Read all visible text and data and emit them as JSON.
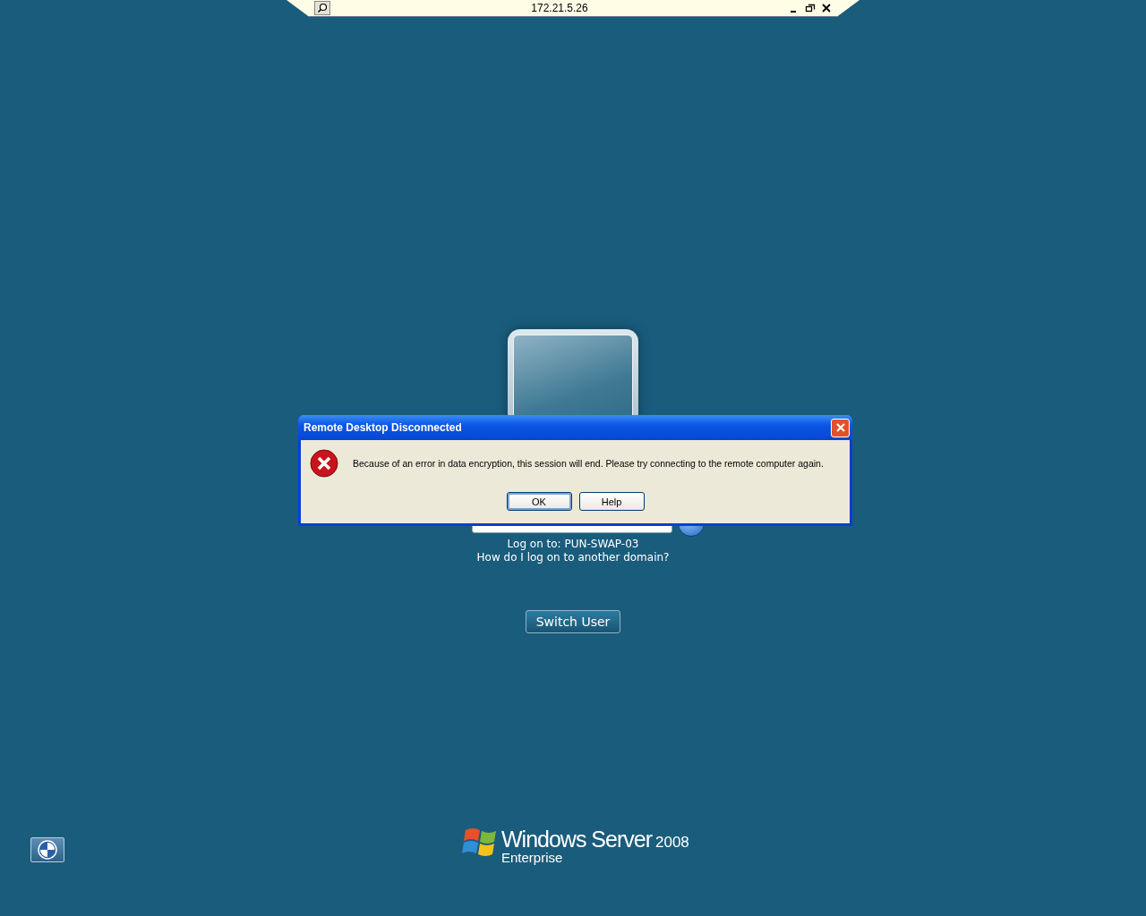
{
  "connection_bar": {
    "title": "172.21.5.26"
  },
  "login": {
    "host_label": "Log on to: PUN-SWAP-03",
    "domain_link": "How do I log on to another domain?",
    "switch_user_button": "Switch User"
  },
  "dialog": {
    "title": "Remote Desktop Disconnected",
    "message": "Because of an error in data encryption, this session will end. Please try connecting to the remote computer again.",
    "buttons": [
      {
        "label": "OK",
        "default": true
      },
      {
        "label": "Help",
        "default": false
      }
    ]
  },
  "branding": {
    "product": "Windows Server",
    "version": "2008",
    "edition": "Enterprise"
  }
}
